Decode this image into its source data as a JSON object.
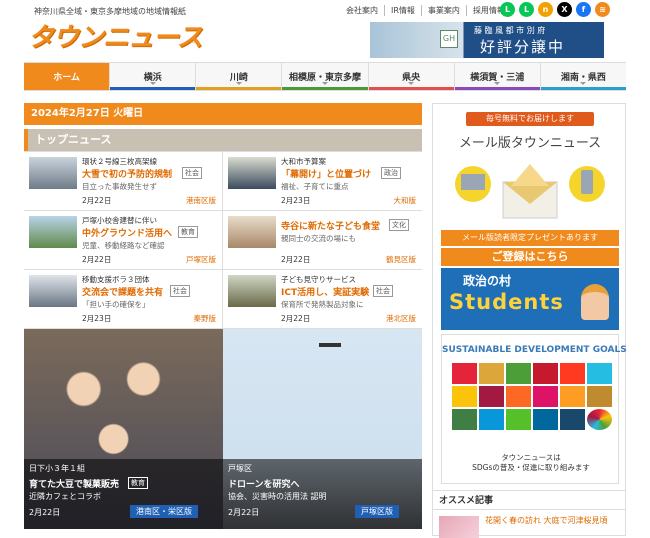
{
  "header": {
    "tagline": "神奈川県全域・東京多摩地域の地域情報紙",
    "logo": "タウンニュース",
    "top_links": [
      "会社案内",
      "IR情報",
      "事業案内",
      "採用情報"
    ],
    "social": [
      {
        "name": "line",
        "color": "#06c755",
        "glyph": "L"
      },
      {
        "name": "line-2",
        "color": "#06c755",
        "glyph": "L"
      },
      {
        "name": "note",
        "color": "#777777",
        "glyph": "n"
      },
      {
        "name": "x",
        "color": "#000000",
        "glyph": "X"
      },
      {
        "name": "facebook",
        "color": "#1877f2",
        "glyph": "f"
      },
      {
        "name": "rss",
        "color": "#f08a1c",
        "glyph": "≋"
      }
    ],
    "ad": {
      "sub": "藤 臨 風 都 市 別 府",
      "main": "好評分譲中",
      "logo": "GH"
    }
  },
  "nav": [
    {
      "label": "ホーム",
      "color": "#f08a1c",
      "active": true
    },
    {
      "label": "横浜",
      "color": "#1f5fb4",
      "active": false
    },
    {
      "label": "川崎",
      "color": "#e0a020",
      "active": false
    },
    {
      "label": "相模原・東京多摩",
      "color": "#4a9a3a",
      "active": false
    },
    {
      "label": "県央",
      "color": "#e05050",
      "active": false
    },
    {
      "label": "横須賀・三浦",
      "color": "#8a4ab8",
      "active": false
    },
    {
      "label": "湘南・県西",
      "color": "#2aa0c8",
      "active": false
    }
  ],
  "main": {
    "date": "2024年2月27日 火曜日",
    "section_title": "トップニュース",
    "news": [
      {
        "kicker": "環状２号線三枚高架線",
        "headline": "大雪で初の予防的規制",
        "tag": "社会",
        "sub": "目立った事故発生せず",
        "date": "2月22日",
        "area": "港南区版",
        "thumb": "#8d9aa6"
      },
      {
        "kicker": "大和市予算案",
        "headline": "「幕開け」と位置づけ",
        "tag": "政治",
        "sub": "福祉、子育てに重点",
        "date": "2月23日",
        "area": "大和版",
        "thumb": "#5f7a4a"
      },
      {
        "kicker": "戸塚小校舎建替に伴い",
        "headline": "中外グラウンド活用へ",
        "tag": "教育",
        "sub": "児童、移動経路など確認",
        "date": "2月22日",
        "area": "戸塚区版",
        "thumb": "#7aa0c8"
      },
      {
        "kicker": "",
        "headline": "寺谷に新たな子ども食堂",
        "tag": "文化",
        "sub": "親同士の交流の場にも",
        "date": "2月22日",
        "area": "鶴見区版",
        "thumb": "#c8a888"
      },
      {
        "kicker": "移動支援ボラ３団体",
        "headline": "交流会で課題を共有",
        "tag": "社会",
        "sub": "「担い手の確保を」",
        "date": "2月23日",
        "area": "秦野版",
        "thumb": "#9aa6b4"
      },
      {
        "kicker": "子ども見守りサービス",
        "headline": "ICT活用し、実証実験",
        "tag": "社会",
        "sub": "保育所で発熱製品対象に",
        "date": "2月22日",
        "area": "港北区版",
        "thumb": "#8a9a7a"
      }
    ],
    "features": [
      {
        "kicker": "日下小３年１組",
        "headline": "育てた大豆で製菓販売",
        "tag": "教育",
        "sub": "近隣カフェとコラボ",
        "date": "2月22日",
        "area": "港南区・栄区版"
      },
      {
        "kicker": "戸塚区",
        "headline": "ドローンを研究へ",
        "tag": "",
        "sub": "協会、災害時の活用法 認明",
        "date": "2月22日",
        "area": "戸塚区版"
      }
    ]
  },
  "sidebar": {
    "mail": {
      "top": "毎号無料でお届けします",
      "title": "メール版タウンニュース",
      "present": "メール版読者限定プレゼントあります",
      "register": "ご登録はこちら"
    },
    "seiji": {
      "title": "政治の村",
      "sub": "Students"
    },
    "sdgs": {
      "title": "SUSTAINABLE DEVELOPMENT GOALS",
      "caption1": "タウンニュースは",
      "caption2": "SDGsの普及・促進に取り組みます"
    },
    "recommend_title": "オススメ記事",
    "recommend_item": "花開く春の訪れ 大庭で河津桜見頃"
  },
  "sdg_colors": [
    "#e5243b",
    "#dda63a",
    "#4c9f38",
    "#c5192d",
    "#ff3a21",
    "#26bde2",
    "#fcc30b",
    "#a21942",
    "#fd6925",
    "#dd1367",
    "#fd9d24",
    "#bf8b2e",
    "#3f7e44",
    "#0a97d9",
    "#56c02b",
    "#00689d",
    "#19486a",
    "#ffffff"
  ]
}
